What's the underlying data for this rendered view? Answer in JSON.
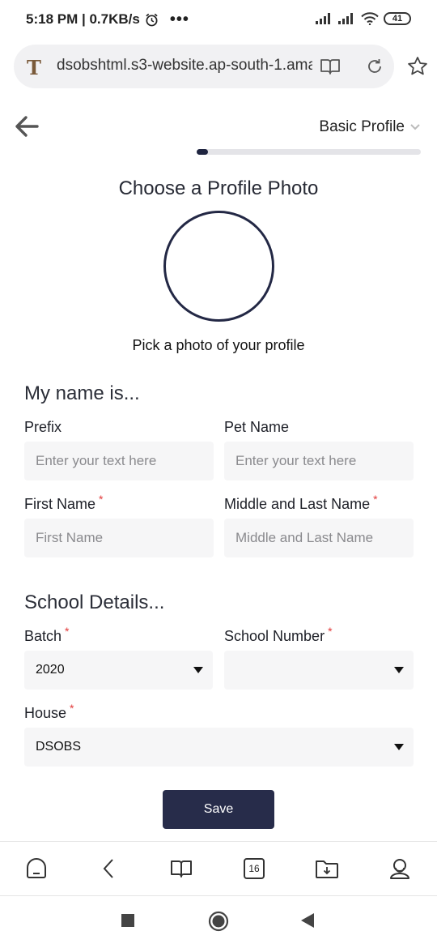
{
  "status_bar": {
    "time_speed": "5:18 PM | 0.7KB/s",
    "more": "•••",
    "battery": "41"
  },
  "browser": {
    "url": "dsobshtml.s3-website.ap-south-1.amazonaws.com",
    "tabs_count": "16"
  },
  "header": {
    "profile_dropdown": "Basic Profile",
    "progress": 0.05
  },
  "photo": {
    "title": "Choose a Profile Photo",
    "caption": "Pick a photo of your profile"
  },
  "name_section": {
    "title": "My name is...",
    "prefix_label": "Prefix",
    "prefix_placeholder": "Enter your text here",
    "pet_name_label": "Pet Name",
    "pet_name_placeholder": "Enter your text here",
    "first_name_label": "First Name",
    "first_name_placeholder": "First Name",
    "middle_last_label": "Middle and Last Name",
    "middle_last_placeholder": "Middle and Last Name",
    "required_mark": "*"
  },
  "school_section": {
    "title": "School Details...",
    "batch_label": "Batch",
    "batch_value": "2020",
    "school_number_label": "School Number",
    "school_number_value": "",
    "house_label": "House",
    "house_value": "DSOBS",
    "required_mark": "*"
  },
  "actions": {
    "save_label": "Save"
  }
}
